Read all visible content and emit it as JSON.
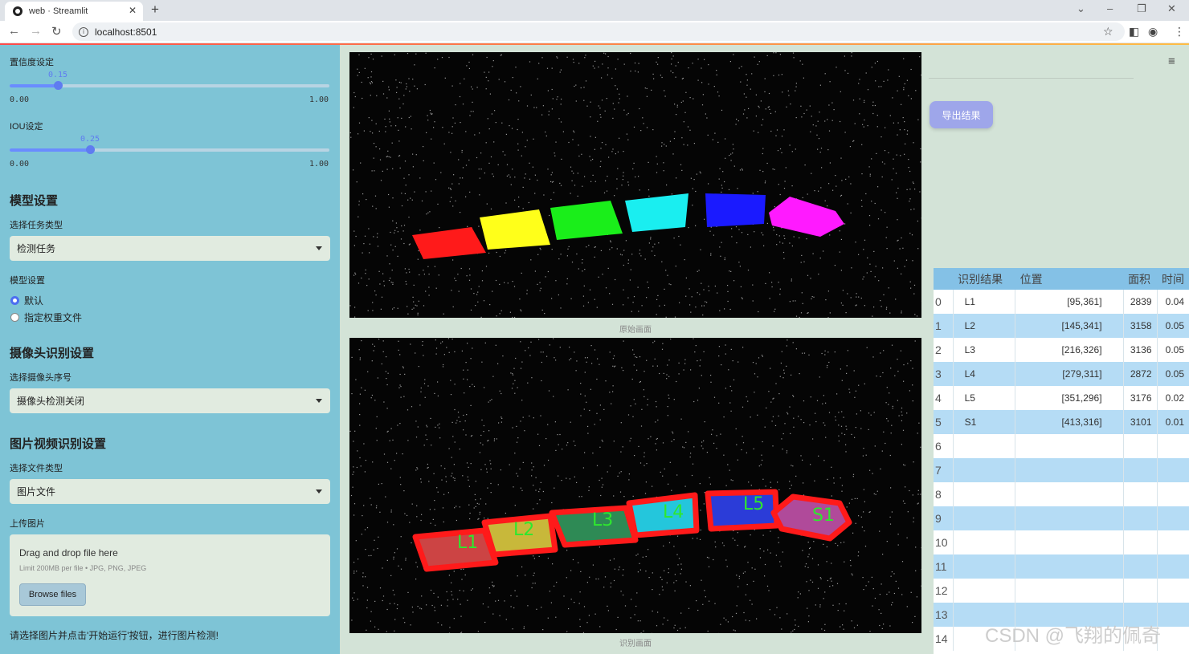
{
  "browser": {
    "tab_title": "web · Streamlit",
    "url": "localhost:8501"
  },
  "sidebar": {
    "conf_label": "置信度设定",
    "conf_value": "0.15",
    "conf_min": "0.00",
    "conf_max": "1.00",
    "conf_level": 0.15,
    "iou_label": "IOU设定",
    "iou_value": "0.25",
    "iou_min": "0.00",
    "iou_max": "1.00",
    "iou_level": 0.25,
    "model_header": "模型设置",
    "task_label": "选择任务类型",
    "task_value": "检测任务",
    "model_label": "模型设置",
    "model_options": [
      "默认",
      "指定权重文件"
    ],
    "model_selected": "默认",
    "camera_header": "摄像头识别设置",
    "camera_label": "选择摄像头序号",
    "camera_value": "摄像头检测关闭",
    "media_header": "图片视频识别设置",
    "filetype_label": "选择文件类型",
    "filetype_value": "图片文件",
    "upload_label": "上传图片",
    "upload_title": "Drag and drop file here",
    "upload_limit": "Limit 200MB per file • JPG, PNG, JPEG",
    "browse_label": "Browse files",
    "hint": "请选择图片并点击'开始运行'按钮，进行图片检测!"
  },
  "main": {
    "orig_caption": "原始画面",
    "result_caption": "识别画面",
    "export_label": "导出结果",
    "detections": [
      {
        "label": "L1",
        "color": "#ff1a1a"
      },
      {
        "label": "L2",
        "color": "#ffff1a"
      },
      {
        "label": "L3",
        "color": "#1aee1a"
      },
      {
        "label": "L4",
        "color": "#1aeef0"
      },
      {
        "label": "L5",
        "color": "#1a1aff"
      },
      {
        "label": "S1",
        "color": "#ff1aff"
      }
    ],
    "table": {
      "columns": [
        "",
        "识别结果",
        "位置",
        "面积",
        "时间"
      ],
      "rows": [
        {
          "idx": "0",
          "name": "L1",
          "pos": "[95,361]",
          "area": "2839",
          "time": "0.04"
        },
        {
          "idx": "1",
          "name": "L2",
          "pos": "[145,341]",
          "area": "3158",
          "time": "0.05"
        },
        {
          "idx": "2",
          "name": "L3",
          "pos": "[216,326]",
          "area": "3136",
          "time": "0.05"
        },
        {
          "idx": "3",
          "name": "L4",
          "pos": "[279,311]",
          "area": "2872",
          "time": "0.05"
        },
        {
          "idx": "4",
          "name": "L5",
          "pos": "[351,296]",
          "area": "3176",
          "time": "0.02"
        },
        {
          "idx": "5",
          "name": "S1",
          "pos": "[413,316]",
          "area": "3101",
          "time": "0.01"
        },
        {
          "idx": "6",
          "name": "",
          "pos": "",
          "area": "",
          "time": ""
        },
        {
          "idx": "7",
          "name": "",
          "pos": "",
          "area": "",
          "time": ""
        },
        {
          "idx": "8",
          "name": "",
          "pos": "",
          "area": "",
          "time": ""
        },
        {
          "idx": "9",
          "name": "",
          "pos": "",
          "area": "",
          "time": ""
        },
        {
          "idx": "10",
          "name": "",
          "pos": "",
          "area": "",
          "time": ""
        },
        {
          "idx": "11",
          "name": "",
          "pos": "",
          "area": "",
          "time": ""
        },
        {
          "idx": "12",
          "name": "",
          "pos": "",
          "area": "",
          "time": ""
        },
        {
          "idx": "13",
          "name": "",
          "pos": "",
          "area": "",
          "time": ""
        },
        {
          "idx": "14",
          "name": "",
          "pos": "",
          "area": "",
          "time": ""
        }
      ]
    }
  },
  "watermark": "CSDN @飞翔的佩奇"
}
